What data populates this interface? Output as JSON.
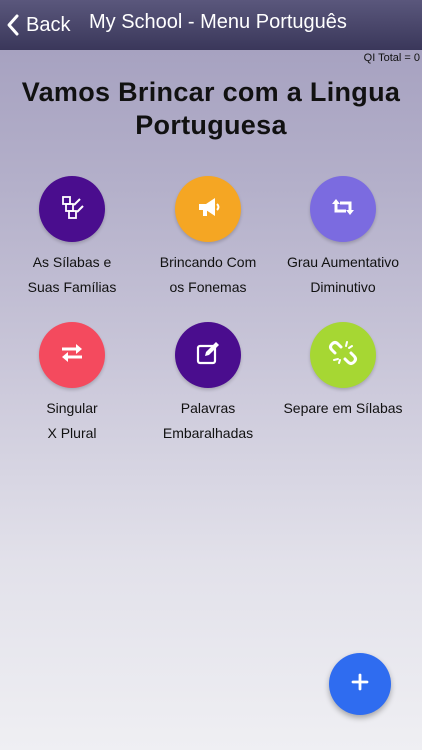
{
  "header": {
    "back_label": "Back",
    "title": "My School - Menu Português"
  },
  "qi_total": "QI Total = 0",
  "page_title": {
    "line1": "Vamos Brincar com a Lingua",
    "line2": "Portuguesa"
  },
  "menu_items": [
    {
      "line1": "As Sílabas e",
      "line2": "Suas Famílias",
      "icon": "blocks-icon",
      "color": "#4a0d8e"
    },
    {
      "line1": "Brincando Com",
      "line2": "os Fonemas",
      "icon": "megaphone-icon",
      "color": "#f5a623"
    },
    {
      "line1": "Grau Aumentativo",
      "line2": "Diminutivo",
      "icon": "retweet-icon",
      "color": "#7b6be0"
    },
    {
      "line1": "Singular",
      "line2": "X Plural",
      "icon": "exchange-icon",
      "color": "#f44a5e"
    },
    {
      "line1": "Palavras",
      "line2": "Embaralhadas",
      "icon": "edit-icon",
      "color": "#4a0d8e"
    },
    {
      "line1": "Separe em Sílabas",
      "line2": "",
      "icon": "broken-link-icon",
      "color": "#a6d733"
    }
  ],
  "fab": {
    "label": "+",
    "icon": "plus-icon",
    "color": "#2f6cf0"
  }
}
